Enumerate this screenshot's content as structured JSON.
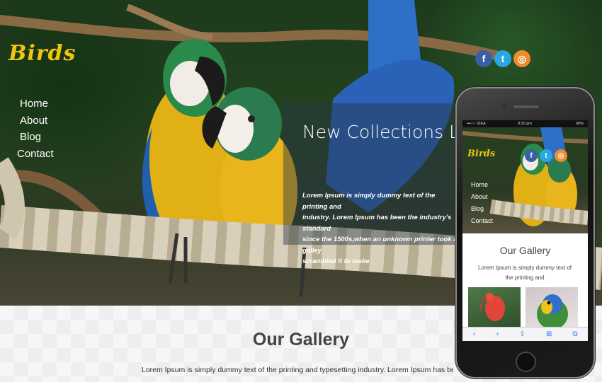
{
  "site": {
    "logo": "Birds",
    "nav": [
      "Home",
      "About",
      "Blog",
      "Contact"
    ],
    "social_icons": [
      "facebook-icon",
      "twitter-icon",
      "dribbble-icon"
    ],
    "social_glyphs": [
      "f",
      "t",
      "◎"
    ]
  },
  "banner": {
    "title": "New Collections Lorem Ipsum is simply dummy text of the printing",
    "text": "Lorem Ipsum is simply dummy text of the printing and\nindustry. Lorem Ipsum has been the industry's standard\nsince the 1500s,when an unknown printer took a galley\nscrambled it to make"
  },
  "gallery": {
    "title": "Our Gallery",
    "text": "Lorem Ipsum is simply dummy text of the printing and typesetting industry. Lorem Ipsum has been the industry's standard dummy text ever since the 1500s,galley of type and scrambled it to make a"
  },
  "phone": {
    "status": {
      "carrier": "•••○○ IDEA",
      "time": "9:20 pm",
      "battery": "90%"
    },
    "logo": "Birds",
    "nav": [
      "Home",
      "About",
      "Blog",
      "Contact"
    ],
    "gallery_title": "Our Gallery",
    "gallery_text": "Lorem Ipsum is simply dummy text of the printing and",
    "browser_icons": [
      "back-icon",
      "forward-icon",
      "share-icon",
      "bookmarks-icon",
      "tabs-icon"
    ],
    "browser_glyphs": [
      "‹",
      "›",
      "⇪",
      "⊞",
      "⧉"
    ]
  },
  "colors": {
    "logo": "#f1c50e",
    "facebook": "#3b5ea6",
    "twitter": "#2aa7e0",
    "dribbble": "#f08a2d"
  }
}
